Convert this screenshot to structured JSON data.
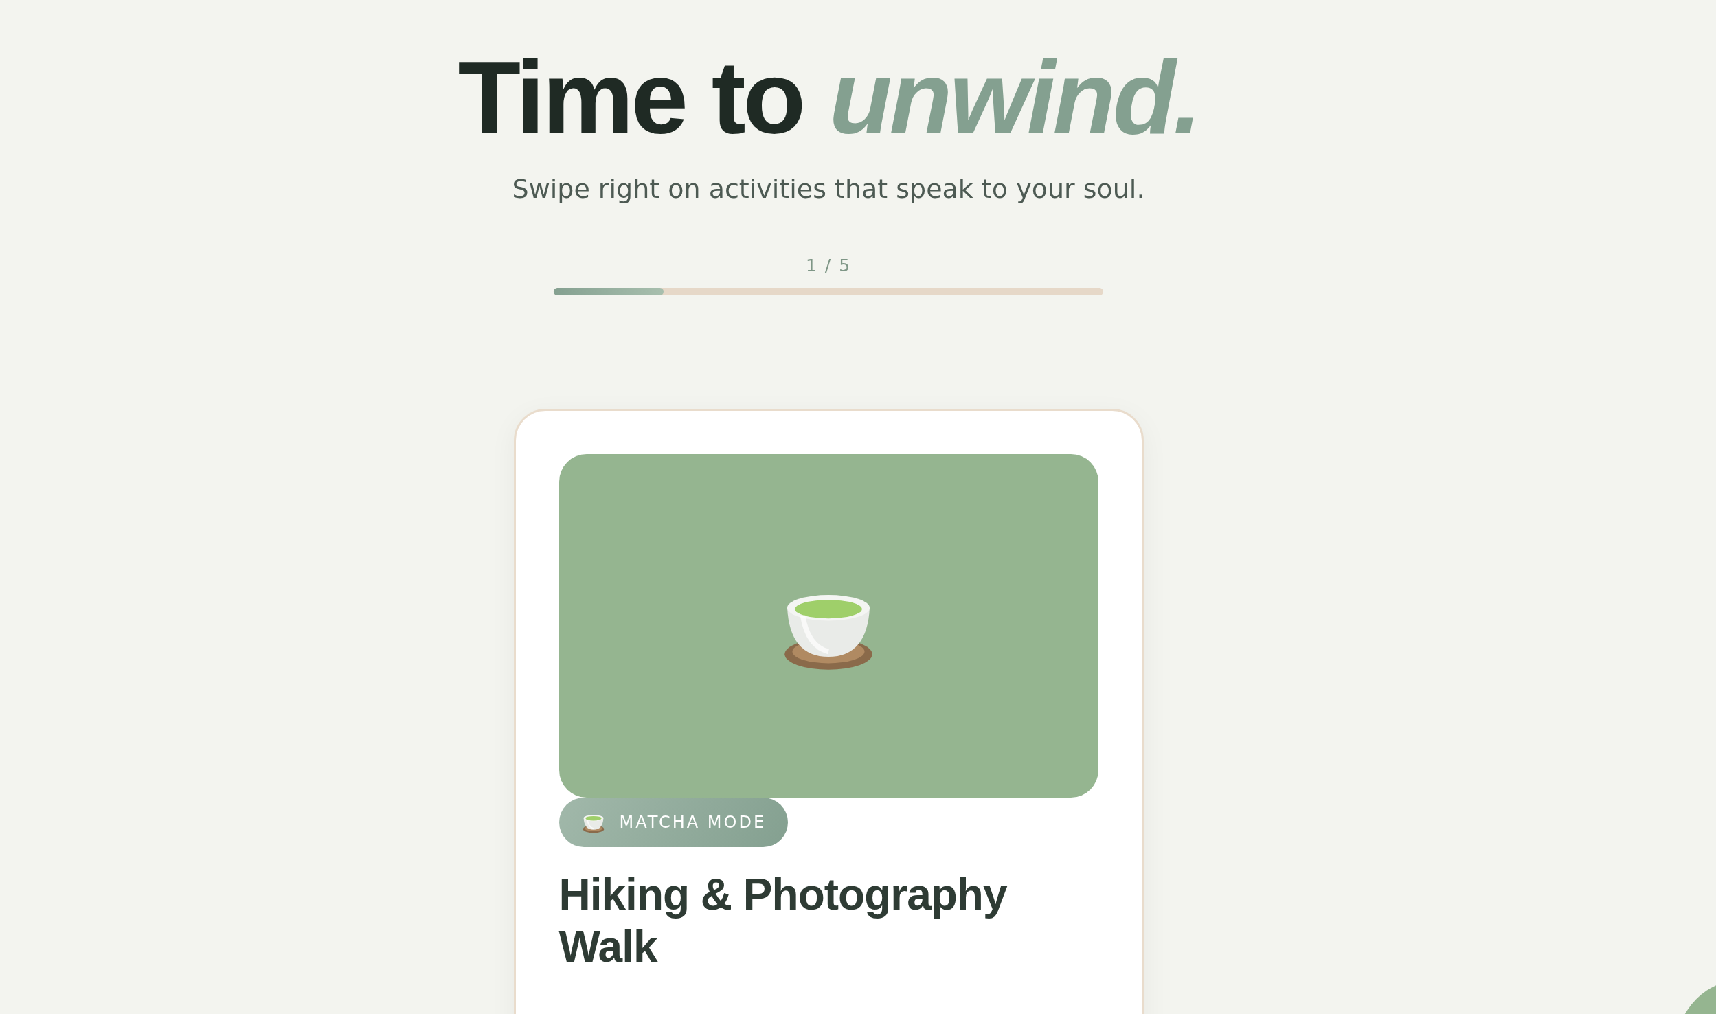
{
  "header": {
    "title": "Time to **unwind.**",
    "subtitle": "Swipe right on activities that speak to your soul."
  },
  "progress": {
    "label": "1 / 5",
    "level": 0.2
  },
  "card": {
    "badge": "MATCHA MODE",
    "title": "Hiking & Photography Walk"
  }
}
